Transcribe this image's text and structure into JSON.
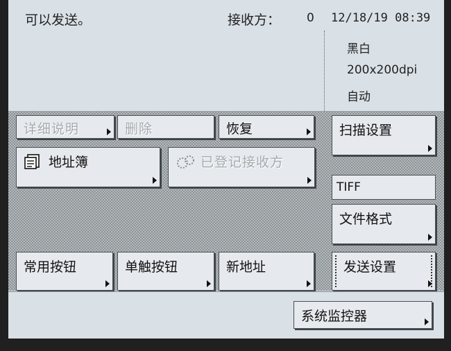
{
  "header": {
    "status": "可以发送。",
    "destinations_label": "接收方：",
    "destinations_count": "0",
    "datetime": "12/18/19 08:39"
  },
  "scan_summary": {
    "color_mode": "黑白",
    "resolution": "200x200dpi",
    "density": "自动"
  },
  "buttons": {
    "dim1": "详细说明",
    "dim2": "删除",
    "restore": "恢复",
    "address_book": "地址簿",
    "registered_dest": "已登记接收方",
    "scan_settings": "扫描设置",
    "file_format_value": "TIFF",
    "file_format": "文件格式",
    "favorites": "常用按钮",
    "one_touch": "单触按钮",
    "new_address": "新地址",
    "send_settings": "发送设置",
    "system_monitor": "系统监控器"
  }
}
